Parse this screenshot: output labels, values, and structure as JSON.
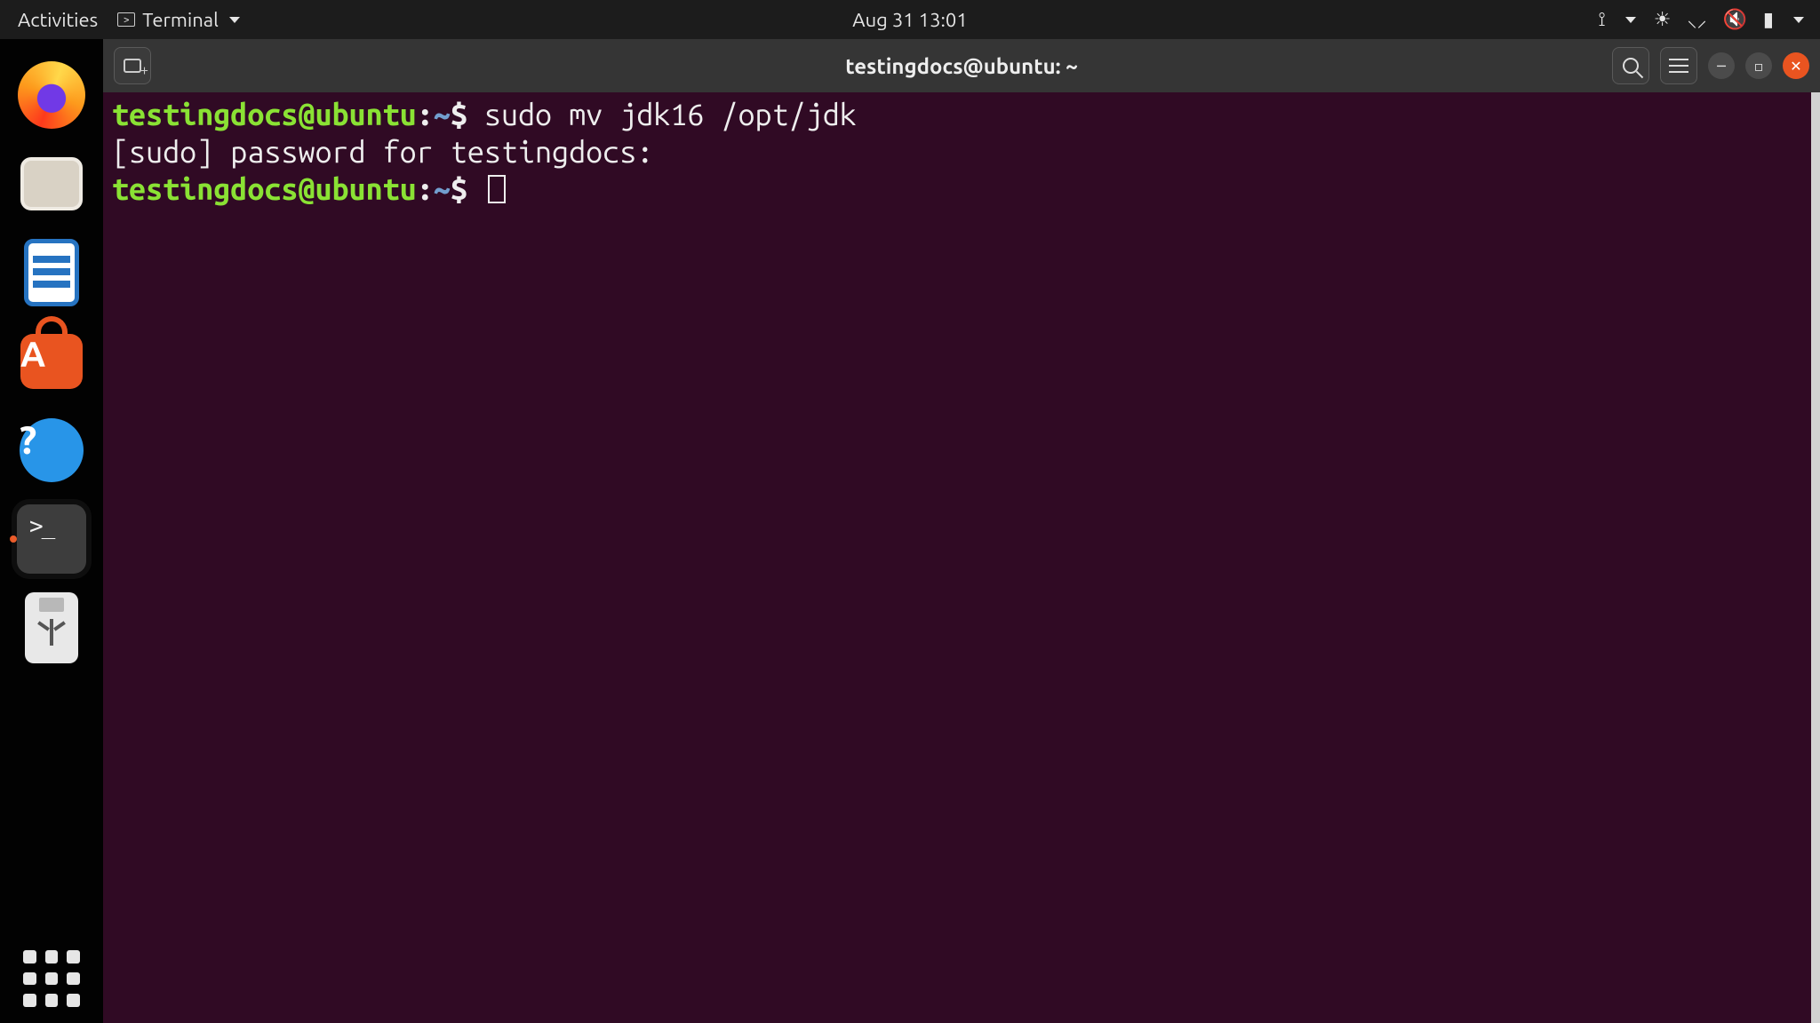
{
  "top_panel": {
    "activities": "Activities",
    "app_name": "Terminal",
    "clock": "Aug 31  13:01"
  },
  "dock": {
    "items": [
      "firefox",
      "files",
      "writer",
      "ubuntu-software",
      "help",
      "terminal",
      "usb-drive"
    ],
    "active_index": 5
  },
  "window": {
    "title": "testingdocs@ubuntu: ~"
  },
  "terminal": {
    "prompt_user_host": "testingdocs@ubuntu",
    "prompt_sep": ":",
    "prompt_path": "~",
    "prompt_end": "$ ",
    "lines": [
      {
        "type": "cmd",
        "command": "sudo mv jdk16 /opt/jdk"
      },
      {
        "type": "output",
        "text": "[sudo] password for testingdocs: "
      },
      {
        "type": "prompt"
      }
    ]
  }
}
